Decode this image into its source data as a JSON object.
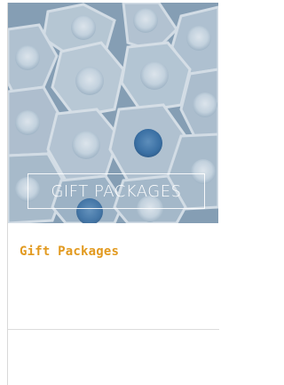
{
  "hero": {
    "label": "GIFT PACKAGES",
    "image_subject": "rows of white cosmetic pump bottles viewed from above"
  },
  "content": {
    "title": "Gift Packages"
  },
  "colors": {
    "title_accent": "#e29a20",
    "hero_tint": "#8ea7bb",
    "border": "#d9d9d9"
  }
}
